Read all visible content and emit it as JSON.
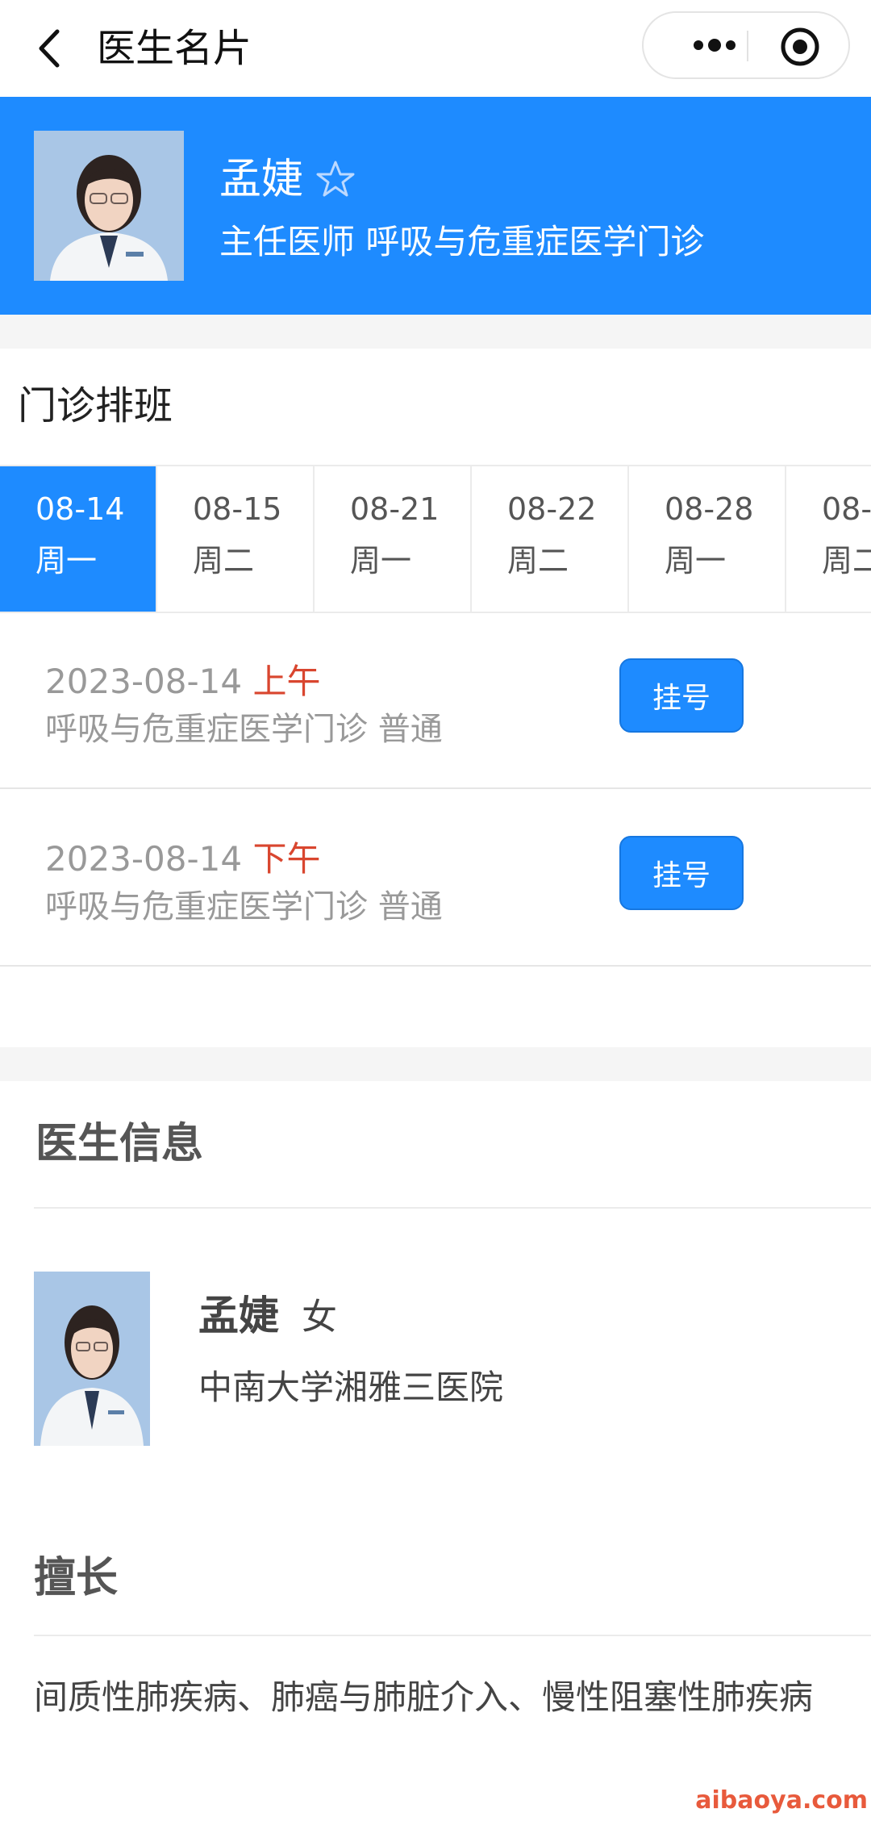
{
  "nav": {
    "title": "医生名片"
  },
  "doctor": {
    "name": "孟婕",
    "title_dept": "主任医师 呼吸与危重症医学门诊"
  },
  "schedule": {
    "title": "门诊排班",
    "dates": [
      {
        "date": "08-14",
        "weekday": "周一",
        "active": true
      },
      {
        "date": "08-15",
        "weekday": "周二",
        "active": false
      },
      {
        "date": "08-21",
        "weekday": "周一",
        "active": false
      },
      {
        "date": "08-22",
        "weekday": "周二",
        "active": false
      },
      {
        "date": "08-28",
        "weekday": "周一",
        "active": false
      },
      {
        "date": "08-",
        "weekday": "周二",
        "active": false
      }
    ],
    "slots": [
      {
        "date": "2023-08-14",
        "period": "上午",
        "dept": "呼吸与危重症医学门诊 普通",
        "button": "挂号"
      },
      {
        "date": "2023-08-14",
        "period": "下午",
        "dept": "呼吸与危重症医学门诊 普通",
        "button": "挂号"
      }
    ]
  },
  "info": {
    "title": "医生信息",
    "name": "孟婕",
    "gender": "女",
    "hospital": "中南大学湘雅三医院"
  },
  "skills": {
    "title": "擅长",
    "text": "间质性肺疾病、肺癌与肺脏介入、慢性阻塞性肺疾病"
  },
  "watermark": "aibaoya.com",
  "colors": {
    "primary": "#1E8BFF",
    "period": "#d9462f"
  }
}
